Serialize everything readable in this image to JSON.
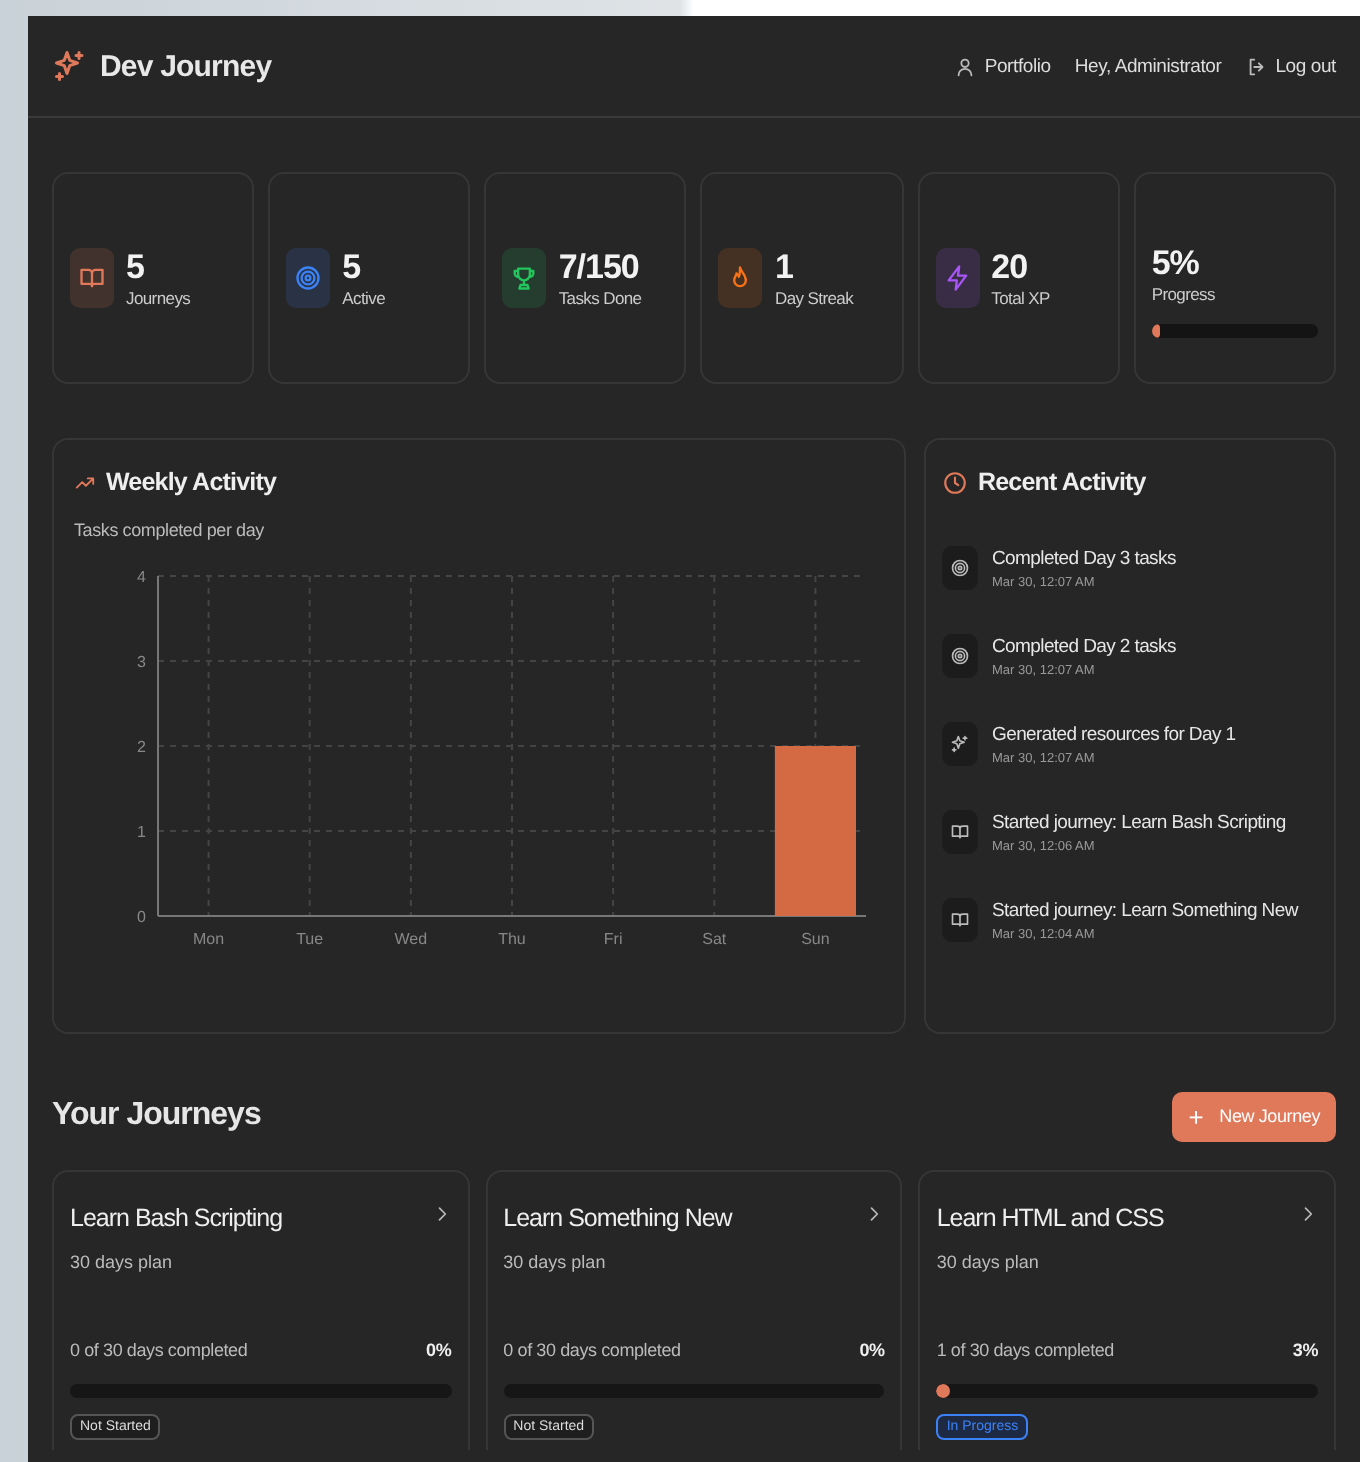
{
  "header": {
    "brand": "Dev Journey",
    "nav": [
      {
        "kind": "portfolio",
        "label": "Portfolio"
      },
      {
        "kind": "greeting",
        "label": "Hey, Administrator"
      },
      {
        "kind": "logout",
        "label": "Log out"
      }
    ]
  },
  "stats": [
    {
      "kind": "book",
      "value": "5",
      "label": "Journeys",
      "color": "#e0785a"
    },
    {
      "kind": "target",
      "value": "5",
      "label": "Active",
      "color": "#3b82f6"
    },
    {
      "kind": "trophy",
      "value": "7/150",
      "label": "Tasks Done",
      "color": "#22c55e"
    },
    {
      "kind": "flame",
      "value": "1",
      "label": "Day Streak",
      "color": "#f97316"
    },
    {
      "kind": "zap",
      "value": "20",
      "label": "Total XP",
      "color": "#a855f7"
    },
    {
      "kind": "progress",
      "value": "5%",
      "label": "Progress",
      "level": 0.05
    }
  ],
  "weekly_activity": {
    "title": "Weekly Activity",
    "subtitle": "Tasks completed per day",
    "chart_data": {
      "type": "bar",
      "categories": [
        "Mon",
        "Tue",
        "Wed",
        "Thu",
        "Fri",
        "Sat",
        "Sun"
      ],
      "values": [
        0,
        0,
        0,
        0,
        0,
        0,
        2
      ],
      "ylim": [
        0,
        4
      ],
      "yticks": [
        0,
        1,
        2,
        3,
        4
      ],
      "grid": true
    }
  },
  "recent_activity": {
    "title": "Recent Activity",
    "items": [
      {
        "kind": "target",
        "text": "Completed Day 3 tasks",
        "time": "Mar 30, 12:07 AM"
      },
      {
        "kind": "target",
        "text": "Completed Day 2 tasks",
        "time": "Mar 30, 12:07 AM"
      },
      {
        "kind": "sparkle",
        "text": "Generated resources for Day 1",
        "time": "Mar 30, 12:07 AM"
      },
      {
        "kind": "book",
        "text": "Started journey: Learn Bash Scripting",
        "time": "Mar 30, 12:06 AM"
      },
      {
        "kind": "book",
        "text": "Started journey: Learn Something New",
        "time": "Mar 30, 12:04 AM"
      }
    ]
  },
  "journeys": {
    "title": "Your Journeys",
    "new_button": {
      "icon": "+",
      "label": "New Journey"
    },
    "items": [
      {
        "title": "Learn Bash Scripting",
        "plan": "30 days plan",
        "progress_text": "0 of 30 days completed",
        "percent": "0%",
        "level": 0,
        "status": {
          "kind": "not-started",
          "label": "Not Started"
        }
      },
      {
        "title": "Learn Something New",
        "plan": "30 days plan",
        "progress_text": "0 of 30 days completed",
        "percent": "0%",
        "level": 0,
        "status": {
          "kind": "not-started",
          "label": "Not Started"
        }
      },
      {
        "title": "Learn HTML and CSS",
        "plan": "30 days plan",
        "progress_text": "1 of 30 days completed",
        "percent": "3%",
        "level": 0.03,
        "status": {
          "kind": "in-progress",
          "label": "In Progress"
        }
      }
    ]
  }
}
